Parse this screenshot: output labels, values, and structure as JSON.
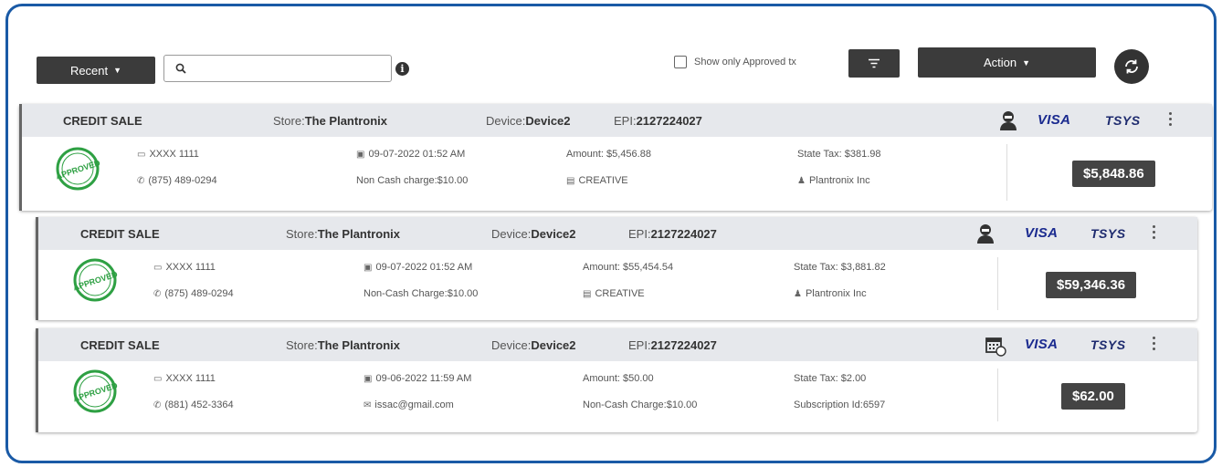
{
  "toolbar": {
    "recent_label": "Recent",
    "search_placeholder": "",
    "approved_only_label": "Show only Approved tx",
    "action_label": "Action"
  },
  "transactions": [
    {
      "type": "CREDIT SALE",
      "store_label": "Store:",
      "store": "The Plantronix",
      "device_label": "Device:",
      "device": "Device2",
      "epi_label": "EPI:",
      "epi": "2127224027",
      "status_icon": "agent-icon",
      "card": "XXXX 1111",
      "phone": "(875) 489-0294",
      "datetime": "09-07-2022 01:52 AM",
      "extra_charge": "Non Cash charge:$10.00",
      "amount": "Amount: $5,456.88",
      "merchant_tag": "CREATIVE",
      "state_tax": "State Tax: $381.98",
      "customer": "Plantronix Inc",
      "total": "$5,848.86",
      "stamp": "APPROVED"
    },
    {
      "type": "CREDIT SALE",
      "store_label": "Store:",
      "store": "The Plantronix",
      "device_label": "Device:",
      "device": "Device2",
      "epi_label": "EPI:",
      "epi": "2127224027",
      "status_icon": "agent-icon",
      "card": "XXXX 1111",
      "phone": "(875) 489-0294",
      "datetime": "09-07-2022 01:52 AM",
      "extra_charge": "Non-Cash Charge:$10.00",
      "amount": "Amount: $55,454.54",
      "merchant_tag": "CREATIVE",
      "state_tax": "State Tax: $3,881.82",
      "customer": "Plantronix Inc",
      "total": "$59,346.36",
      "stamp": "APPROVED"
    },
    {
      "type": "CREDIT SALE",
      "store_label": "Store:",
      "store": "The Plantronix",
      "device_label": "Device:",
      "device": "Device2",
      "epi_label": "EPI:",
      "epi": "2127224027",
      "status_icon": "calendar-icon",
      "card": "XXXX 1111",
      "phone": "(881) 452-3364",
      "datetime": "09-06-2022 11:59 AM",
      "email": "issac@gmail.com",
      "amount": "Amount: $50.00",
      "extra_charge": "Non-Cash Charge:$10.00",
      "state_tax": "State Tax: $2.00",
      "subscription": "Subscription Id:6597",
      "total": "$62.00",
      "stamp": "APPROVED"
    }
  ],
  "brand": {
    "visa": "VISA",
    "tsys": "TSYS"
  },
  "colors": {
    "frame": "#1a5aa6",
    "approved": "#2ea043",
    "dark": "#3b3b3b"
  }
}
